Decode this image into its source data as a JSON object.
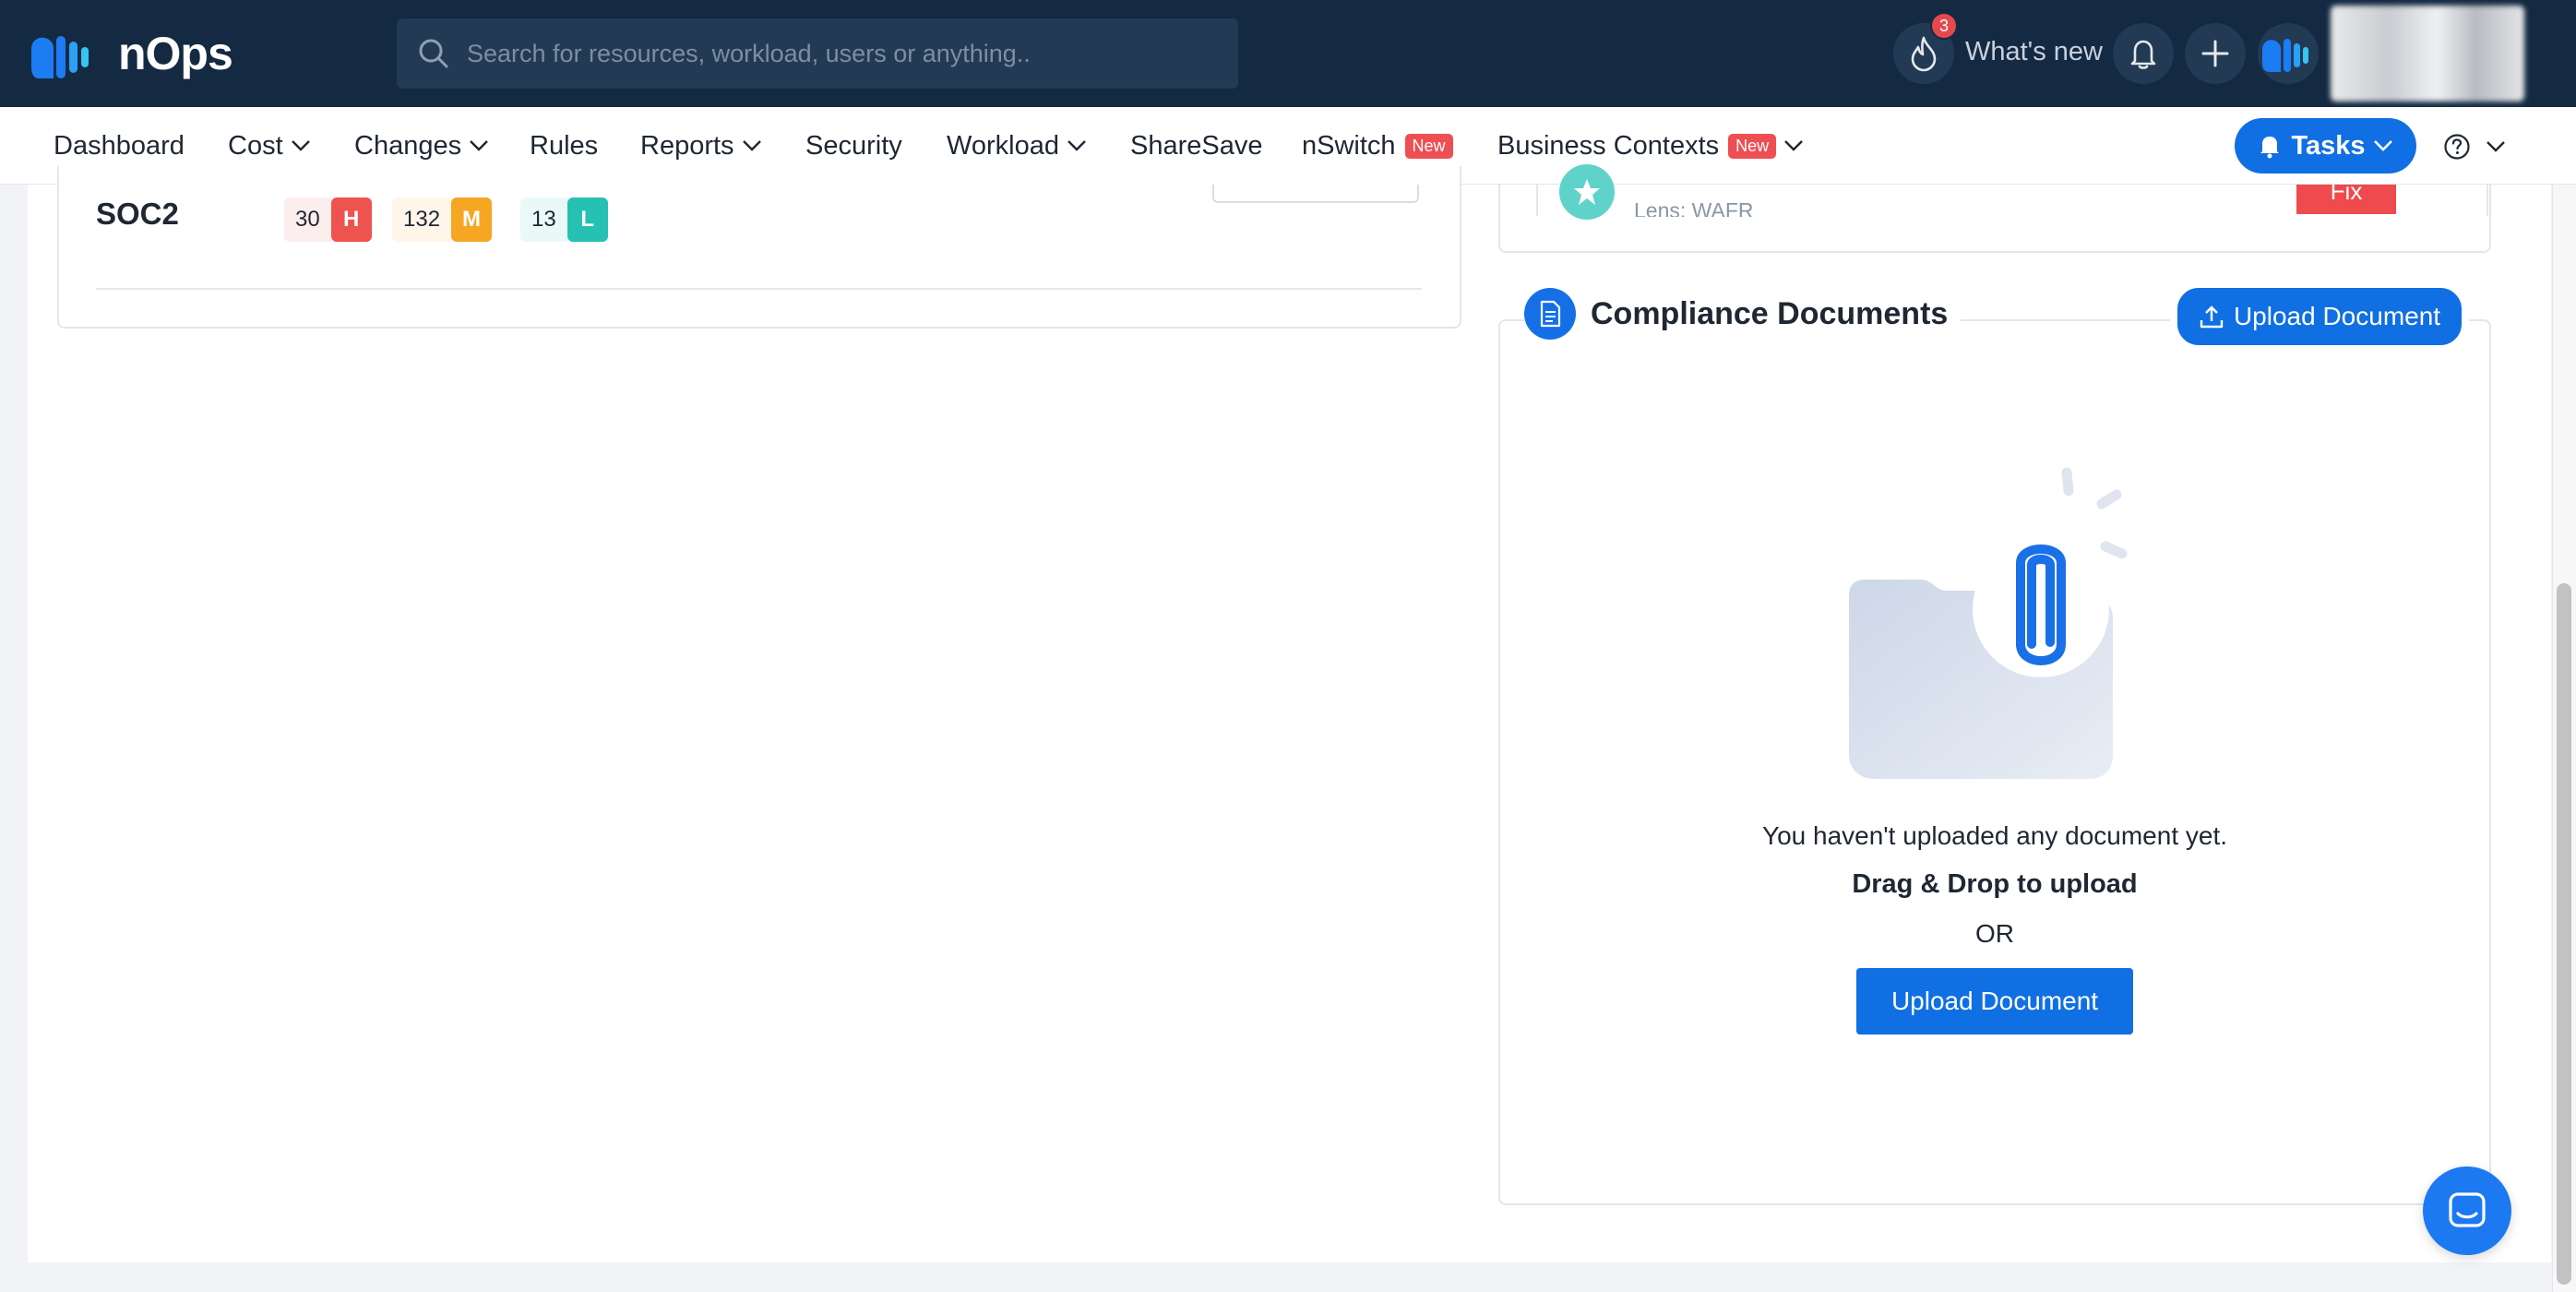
{
  "app": {
    "name": "nOps",
    "search_placeholder": "Search for resources, workload, users or anything..",
    "notifications_count": "3",
    "whats_new_label": "What's new"
  },
  "nav": {
    "items": [
      {
        "label": "Dashboard"
      },
      {
        "label": "Cost"
      },
      {
        "label": "Changes"
      },
      {
        "label": "Rules"
      },
      {
        "label": "Reports"
      },
      {
        "label": "Security"
      },
      {
        "label": "Workload"
      },
      {
        "label": "ShareSave"
      },
      {
        "label": "nSwitch",
        "badge": "New"
      },
      {
        "label": "Business Contexts",
        "badge": "New"
      }
    ],
    "tasks_label": "Tasks"
  },
  "framework": {
    "name": "SOC2",
    "high_count": "30",
    "high_label": "H",
    "medium_count": "132",
    "medium_label": "M",
    "low_count": "13",
    "low_label": "L"
  },
  "pillar_item": {
    "lens": "Lens: WAFR",
    "action": "Fix"
  },
  "compliance": {
    "title": "Compliance Documents",
    "upload_top_label": "Upload Document",
    "empty_message": "You haven't uploaded any document yet.",
    "drag_drop": "Drag & Drop to upload",
    "or": "OR",
    "upload_label": "Upload Document"
  },
  "colors": {
    "topbar": "#142a42",
    "accent": "#0f6fe3",
    "high": "#ef5350",
    "medium": "#f5a623",
    "low": "#26c1b3"
  }
}
